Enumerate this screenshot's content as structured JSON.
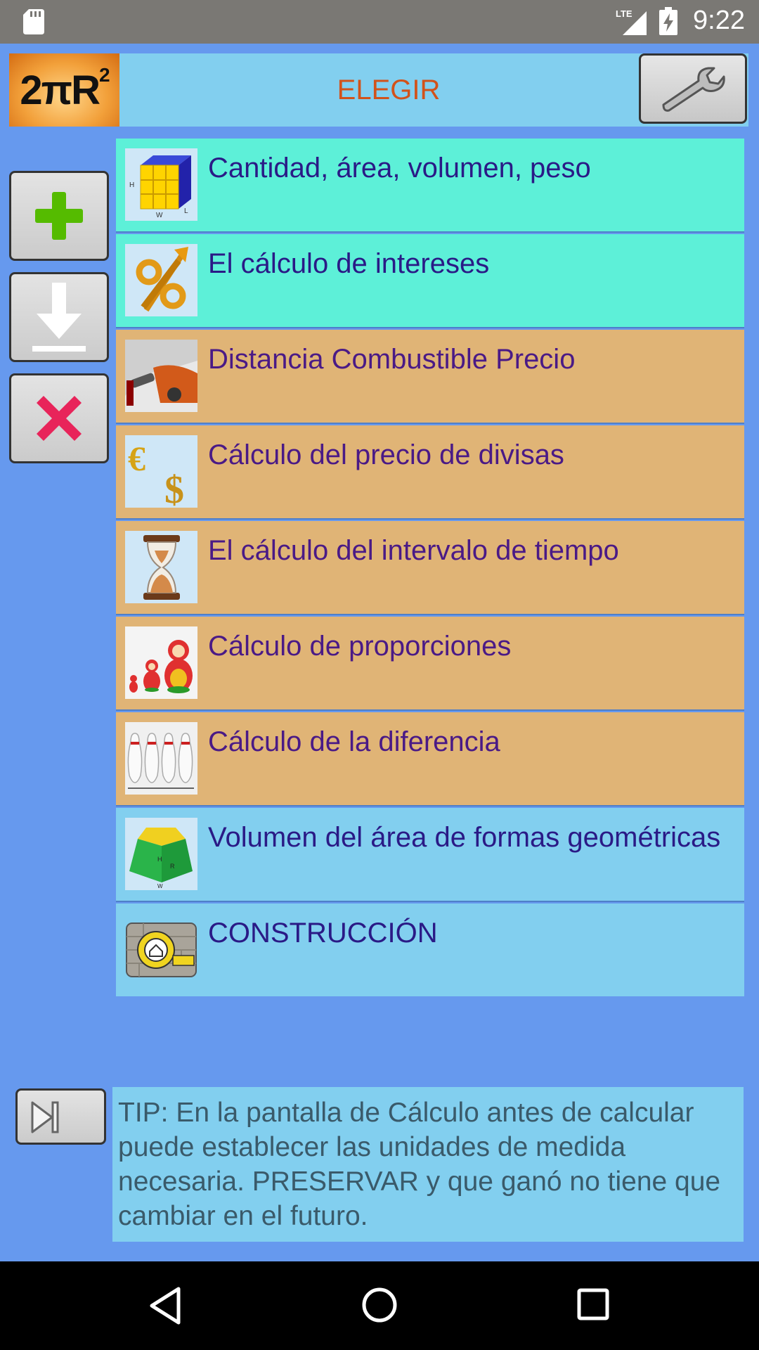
{
  "status_bar": {
    "time": "9:22",
    "network": "LTE"
  },
  "header": {
    "logo_text": "2πR",
    "logo_exponent": "2",
    "title": "ELEGIR"
  },
  "side_buttons": [
    {
      "name": "add",
      "icon": "plus-icon",
      "color": "#55bb00"
    },
    {
      "name": "download",
      "icon": "download-icon",
      "color": "#ffffff"
    },
    {
      "name": "delete",
      "icon": "close-icon",
      "color": "#e8245a"
    }
  ],
  "menu": {
    "items": [
      {
        "label": "Cantidad, área, volumen, peso",
        "icon": "cube-icon",
        "color": "#5df0d8"
      },
      {
        "label": "El cálculo de intereses",
        "icon": "percent-icon",
        "color": "#5df0d8"
      },
      {
        "label": "Distancia Combustible Precio",
        "icon": "fuel-icon",
        "color": "#e0b476"
      },
      {
        "label": "Cálculo del precio de divisas",
        "icon": "currency-icon",
        "color": "#e0b476"
      },
      {
        "label": "El cálculo del intervalo de tiempo",
        "icon": "hourglass-icon",
        "color": "#e0b476"
      },
      {
        "label": "Cálculo de proporciones",
        "icon": "matryoshka-icon",
        "color": "#e0b476"
      },
      {
        "label": "Cálculo de la diferencia",
        "icon": "bowling-pins-icon",
        "color": "#e0b476"
      },
      {
        "label": "Volumen del área de formas geométricas",
        "icon": "geometric-shape-icon",
        "color": "#82cfef"
      },
      {
        "label": "CONSTRUCCIÓN",
        "icon": "construction-icon",
        "color": "#82cfef"
      }
    ]
  },
  "tip": {
    "text": "TIP: En la pantalla de Cálculo antes de calcular puede establecer las unidades de medida necesaria. PRESERVAR y que ganó no tiene que cambiar en el futuro."
  }
}
